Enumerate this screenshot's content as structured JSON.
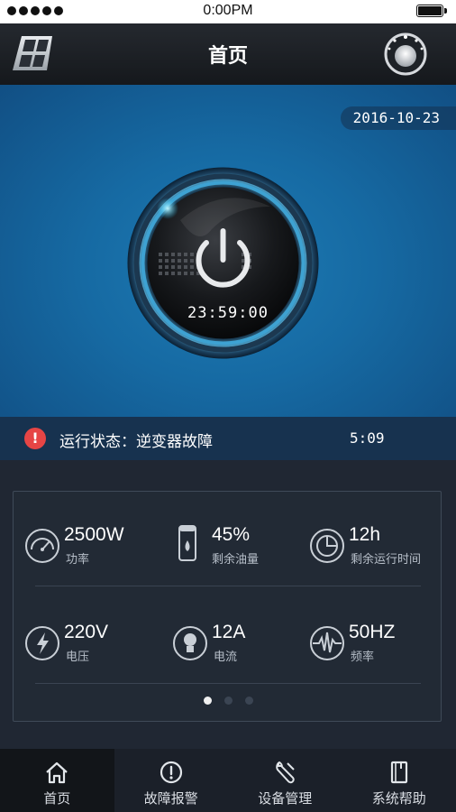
{
  "status_bar": {
    "time": "0:00PM",
    "signal_bars": 5
  },
  "header": {
    "title": "首页"
  },
  "hero": {
    "date": "2016-10-23",
    "timer": "23:59:00"
  },
  "run_status": {
    "label": "运行状态：逆变器故障",
    "time": "5:09",
    "icon": "alert-icon"
  },
  "metrics": [
    {
      "value": "2500W",
      "label": "功率",
      "icon": "power-meter-icon"
    },
    {
      "value": "45%",
      "label": "剩余油量",
      "icon": "fuel-tank-icon"
    },
    {
      "value": "12h",
      "label": "剩余运行时间",
      "icon": "clock-pie-icon"
    },
    {
      "value": "220V",
      "label": "电压",
      "icon": "lightning-icon"
    },
    {
      "value": "12A",
      "label": "电流",
      "icon": "bulb-icon"
    },
    {
      "value": "50HZ",
      "label": "频率",
      "icon": "waveform-icon"
    }
  ],
  "pager": {
    "pages": 3,
    "current": 1
  },
  "tabs": [
    {
      "label": "首页",
      "icon": "home-icon",
      "active": true
    },
    {
      "label": "故障报警",
      "icon": "alarm-icon",
      "active": false
    },
    {
      "label": "设备管理",
      "icon": "wrench-icon",
      "active": false
    },
    {
      "label": "系统帮助",
      "icon": "book-icon",
      "active": false
    }
  ],
  "colors": {
    "accent": "#1e7bb4",
    "alert": "#e64545",
    "background": "#202733"
  }
}
